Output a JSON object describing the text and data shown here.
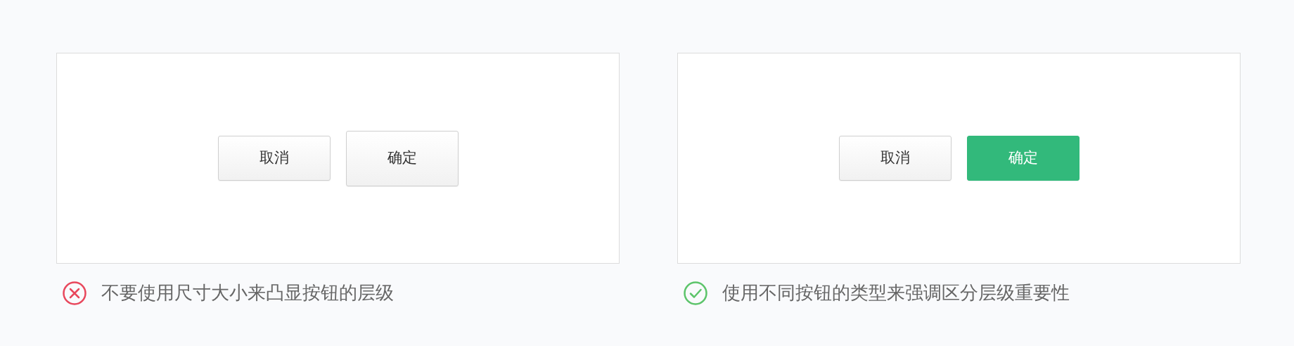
{
  "examples": [
    {
      "correct": false,
      "buttons": [
        {
          "label": "取消",
          "kind": "default"
        },
        {
          "label": "确定",
          "kind": "large"
        }
      ],
      "caption": "不要使用尺寸大小来凸显按钮的层级"
    },
    {
      "correct": true,
      "buttons": [
        {
          "label": "取消",
          "kind": "default"
        },
        {
          "label": "确定",
          "kind": "primary"
        }
      ],
      "caption": "使用不同按钮的类型来强调区分层级重要性"
    }
  ]
}
